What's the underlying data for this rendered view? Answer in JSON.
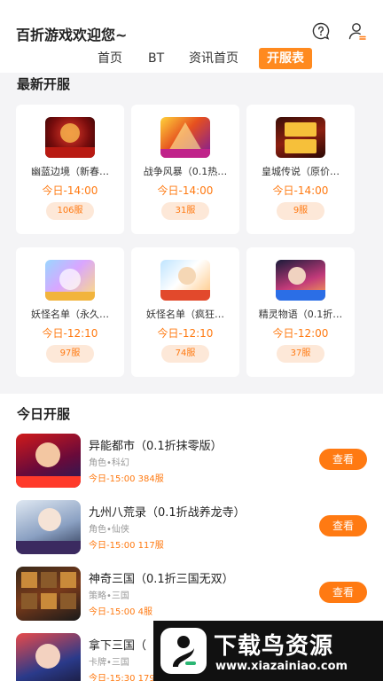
{
  "header": {
    "title": "百折游戏欢迎您~",
    "help_icon": "help-chat-icon",
    "user_icon": "user-icon"
  },
  "tabs": [
    {
      "label": "首页",
      "active": false
    },
    {
      "label": "BT",
      "active": false
    },
    {
      "label": "资讯首页",
      "active": false
    },
    {
      "label": "开服表",
      "active": true
    }
  ],
  "latest": {
    "title": "最新开服",
    "cards": [
      {
        "name": "幽蓝边境（新春…",
        "time": "今日-14:00",
        "servers": "106服"
      },
      {
        "name": "战争风暴（0.1热…",
        "time": "今日-14:00",
        "servers": "31服"
      },
      {
        "name": "皇城传说（原价…",
        "time": "今日-14:00",
        "servers": "9服"
      },
      {
        "name": "妖怪名单（永久…",
        "time": "今日-12:10",
        "servers": "97服"
      },
      {
        "name": "妖怪名单（疯狂…",
        "time": "今日-12:10",
        "servers": "74服"
      },
      {
        "name": "精灵物语（0.1折…",
        "time": "今日-12:00",
        "servers": "37服"
      }
    ]
  },
  "today": {
    "title": "今日开服",
    "button_label": "查看",
    "games": [
      {
        "name": "异能都市（0.1折抹零版）",
        "category": "角色•科幻",
        "time": "今日-15:00 384服"
      },
      {
        "name": "九州八荒录（0.1折战养龙寺）",
        "category": "角色•仙侠",
        "time": "今日-15:00 117服"
      },
      {
        "name": "神奇三国（0.1折三国无双）",
        "category": "策略•三国",
        "time": "今日-15:00 4服"
      },
      {
        "name": "拿下三国（",
        "category": "卡牌•三国",
        "time": "今日-15:30 179服"
      }
    ]
  },
  "watermark": {
    "text": "下载鸟资源",
    "url": "www.xiazainiao.com"
  },
  "colors": {
    "accent": "#ff7a12",
    "tab_active": "#ff8a1f",
    "background": "#f4f4f6"
  }
}
